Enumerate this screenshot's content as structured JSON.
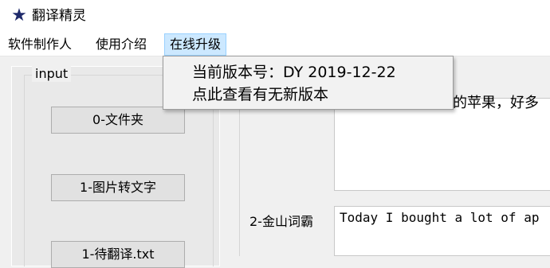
{
  "window": {
    "title": "翻译精灵",
    "icon": "star-icon"
  },
  "menu": {
    "items": [
      {
        "label": "软件制作人"
      },
      {
        "label": "使用介绍"
      },
      {
        "label": "在线升级"
      }
    ]
  },
  "dropdown": {
    "items": [
      {
        "label": "当前版本号：DY 2019-12-22"
      },
      {
        "label": "点此查看有无新版本"
      }
    ]
  },
  "input_group": {
    "legend": "input",
    "buttons": [
      {
        "label": "0-文件夹"
      },
      {
        "label": "1-图片转文字"
      },
      {
        "label": "1-待翻译.txt"
      }
    ]
  },
  "output": {
    "box1_visible_text": "的苹果，好多",
    "box2_label": "2-金山词霸",
    "box2_text": "Today I bought a lot of ap"
  },
  "colors": {
    "menu_active_bg": "#cce8ff",
    "menu_active_border": "#99d1ff",
    "icon_color": "#1f2a6b"
  }
}
